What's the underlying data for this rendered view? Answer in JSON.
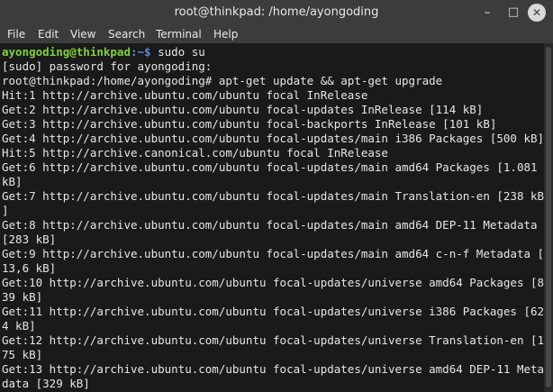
{
  "window": {
    "title": "root@thinkpad: /home/ayongoding",
    "min_symbol": "–",
    "max_symbol": "□",
    "close_symbol": "✕"
  },
  "menu": {
    "file": "File",
    "edit": "Edit",
    "view": "View",
    "search": "Search",
    "terminal": "Terminal",
    "help": "Help"
  },
  "terminal": {
    "prompt_user": "ayongoding@thinkpad",
    "prompt_path": ":~$ ",
    "command1": "sudo su",
    "lines": [
      "[sudo] password for ayongoding:",
      "root@thinkpad:/home/ayongoding# apt-get update && apt-get upgrade",
      "Hit:1 http://archive.ubuntu.com/ubuntu focal InRelease",
      "Get:2 http://archive.ubuntu.com/ubuntu focal-updates InRelease [114 kB]",
      "Get:3 http://archive.ubuntu.com/ubuntu focal-backports InRelease [101 kB]",
      "Get:4 http://archive.ubuntu.com/ubuntu focal-updates/main i386 Packages [500 kB]",
      "Hit:5 http://archive.canonical.com/ubuntu focal InRelease",
      "Get:6 http://archive.ubuntu.com/ubuntu focal-updates/main amd64 Packages [1.081",
      "kB]",
      "Get:7 http://archive.ubuntu.com/ubuntu focal-updates/main Translation-en [238 kB",
      "]",
      "Get:8 http://archive.ubuntu.com/ubuntu focal-updates/main amd64 DEP-11 Metadata",
      "[283 kB]",
      "Get:9 http://archive.ubuntu.com/ubuntu focal-updates/main amd64 c-n-f Metadata [",
      "13,6 kB]",
      "Get:10 http://archive.ubuntu.com/ubuntu focal-updates/universe amd64 Packages [8",
      "39 kB]",
      "Get:11 http://archive.ubuntu.com/ubuntu focal-updates/universe i386 Packages [62",
      "4 kB]",
      "Get:12 http://archive.ubuntu.com/ubuntu focal-updates/universe Translation-en [1",
      "75 kB]",
      "Get:13 http://archive.ubuntu.com/ubuntu focal-updates/universe amd64 DEP-11 Meta",
      "data [329 kB]"
    ]
  }
}
